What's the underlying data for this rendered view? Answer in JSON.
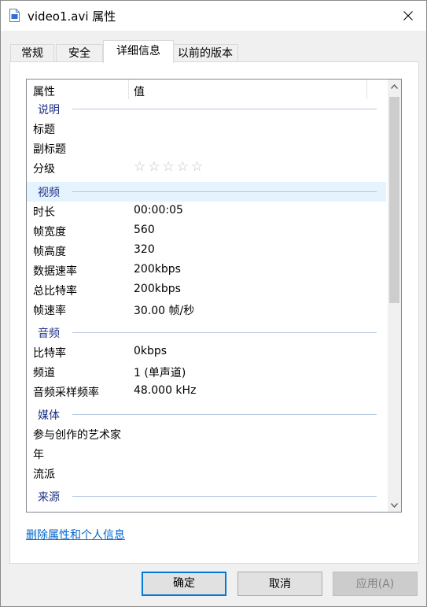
{
  "window": {
    "title": "video1.avi 属性"
  },
  "tabs": [
    {
      "label": "常规"
    },
    {
      "label": "安全"
    },
    {
      "label": "详细信息"
    },
    {
      "label": "以前的版本"
    }
  ],
  "columns": {
    "property": "属性",
    "value": "值"
  },
  "groups": {
    "description": "说明",
    "video": "视频",
    "audio": "音频",
    "media": "媒体",
    "source": "来源"
  },
  "rows": {
    "title": {
      "key": "标题",
      "value": ""
    },
    "subtitle": {
      "key": "副标题",
      "value": ""
    },
    "rating": {
      "key": "分级",
      "value": "☆☆☆☆☆",
      "stars_filled": 0,
      "stars_total": 5
    },
    "duration": {
      "key": "时长",
      "value": "00:00:05"
    },
    "frame_width": {
      "key": "帧宽度",
      "value": "560"
    },
    "frame_height": {
      "key": "帧高度",
      "value": "320"
    },
    "data_rate": {
      "key": "数据速率",
      "value": "200kbps"
    },
    "total_bitrate": {
      "key": "总比特率",
      "value": "200kbps"
    },
    "frame_rate": {
      "key": "帧速率",
      "value": "30.00 帧/秒"
    },
    "audio_bitrate": {
      "key": "比特率",
      "value": "0kbps"
    },
    "channels": {
      "key": "频道",
      "value": "1 (单声道)"
    },
    "sample_rate": {
      "key": "音频采样频率",
      "value": "48.000 kHz"
    },
    "contributing_artists": {
      "key": "参与创作的艺术家",
      "value": ""
    },
    "year": {
      "key": "年",
      "value": ""
    },
    "genre": {
      "key": "流派",
      "value": ""
    }
  },
  "link": {
    "remove_props": "删除属性和个人信息"
  },
  "buttons": {
    "ok": "确定",
    "cancel": "取消",
    "apply": "应用(A)"
  },
  "colors": {
    "group_text": "#1e3287",
    "link": "#0066cc",
    "accent": "#0078d7",
    "selected_row": "#e5f3ff"
  },
  "icons": {
    "file": "file-icon",
    "close": "close-icon"
  }
}
